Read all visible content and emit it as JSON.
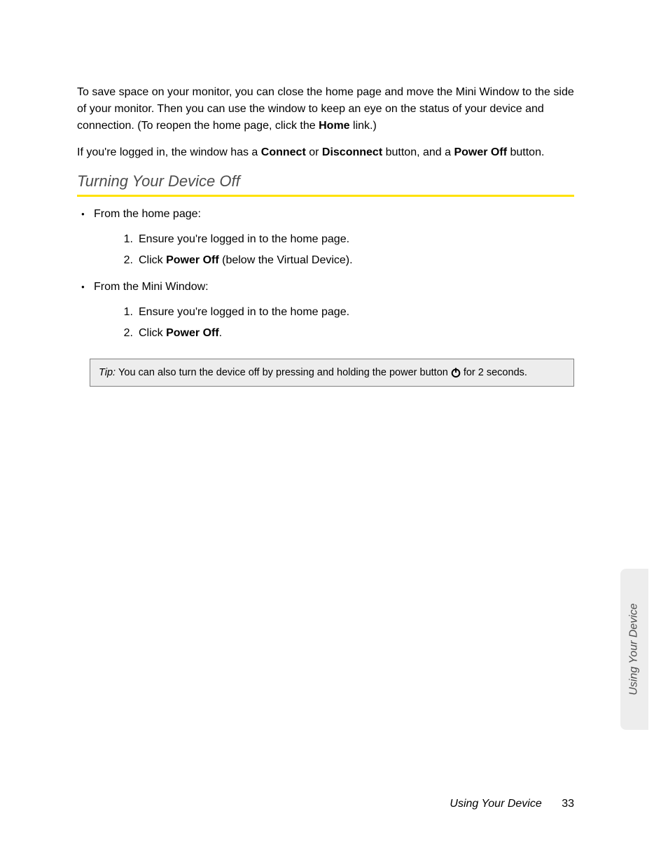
{
  "intro": {
    "p1a": "To save space on your monitor, you can close the home page and move the Mini Window to the side of your monitor. Then you can use the window to keep an eye on the status of your device and connection. (To reopen the home page, click the ",
    "p1_bold": "Home",
    "p1b": " link.)",
    "p2a": "If you're logged in, the window has a ",
    "p2_b1": "Connect",
    "p2_mid1": " or ",
    "p2_b2": "Disconnect",
    "p2_mid2": " button, and a ",
    "p2_b3": "Power Off",
    "p2_end": " button."
  },
  "heading": "Turning Your Device Off",
  "list1": {
    "intro": "From the home page:",
    "n1": "1.",
    "s1": "Ensure you're logged in to the home page.",
    "n2": "2.",
    "s2a": "Click ",
    "s2b": "Power Off",
    "s2c": " (below the Virtual Device)."
  },
  "list2": {
    "intro": "From the Mini Window:",
    "n1": "1.",
    "s1": "Ensure you're logged in to the home page.",
    "n2": "2.",
    "s2a": "Click ",
    "s2b": "Power Off",
    "s2c": "."
  },
  "tip": {
    "label": "Tip:",
    "t1": " You can also turn the device off by pressing and holding the power button ",
    "t2": " for 2 seconds."
  },
  "sideTab": "Using Your Device",
  "footer": {
    "section": "Using Your Device",
    "page": "33"
  }
}
